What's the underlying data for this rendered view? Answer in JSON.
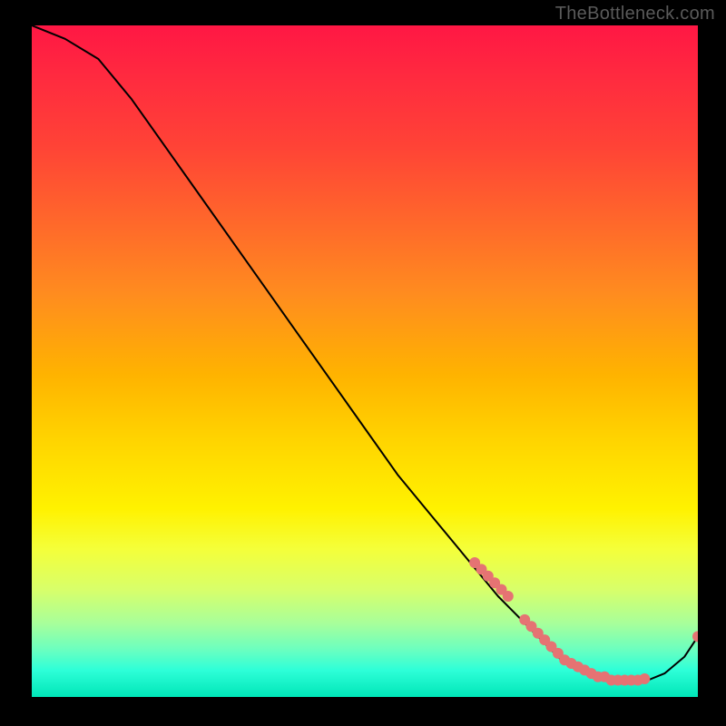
{
  "watermark": "TheBottleneck.com",
  "chart_data": {
    "type": "line",
    "title": "",
    "xlabel": "",
    "ylabel": "",
    "xlim": [
      0,
      100
    ],
    "ylim": [
      0,
      100
    ],
    "series": [
      {
        "name": "bottleneck-curve",
        "x": [
          0,
          5,
          10,
          15,
          20,
          25,
          30,
          35,
          40,
          45,
          50,
          55,
          60,
          65,
          70,
          72,
          75,
          78,
          80,
          82,
          84,
          86,
          88,
          90,
          92,
          95,
          98,
          100
        ],
        "y": [
          100,
          98,
          95,
          89,
          82,
          75,
          68,
          61,
          54,
          47,
          40,
          33,
          27,
          21,
          15,
          13,
          10,
          7,
          5,
          4,
          3,
          2.5,
          2,
          2,
          2.3,
          3.5,
          6,
          9
        ]
      }
    ],
    "marker_points": {
      "name": "highlighted-range",
      "color": "#e57373",
      "x": [
        66.5,
        67.5,
        68.5,
        69.5,
        70.5,
        71.5,
        74,
        75,
        76,
        77,
        78,
        79,
        80,
        81,
        82,
        83,
        84,
        85,
        86,
        87,
        88,
        89,
        90,
        91,
        92,
        100
      ],
      "y": [
        20,
        19,
        18,
        17,
        16,
        15,
        11.5,
        10.5,
        9.5,
        8.5,
        7.5,
        6.5,
        5.5,
        5,
        4.5,
        4,
        3.5,
        3,
        3,
        2.5,
        2.5,
        2.5,
        2.5,
        2.5,
        2.7,
        9
      ]
    },
    "gradient_stops": [
      {
        "pos": 0,
        "color": "#ff1744"
      },
      {
        "pos": 50,
        "color": "#ffd500"
      },
      {
        "pos": 100,
        "color": "#00e6b8"
      }
    ]
  }
}
